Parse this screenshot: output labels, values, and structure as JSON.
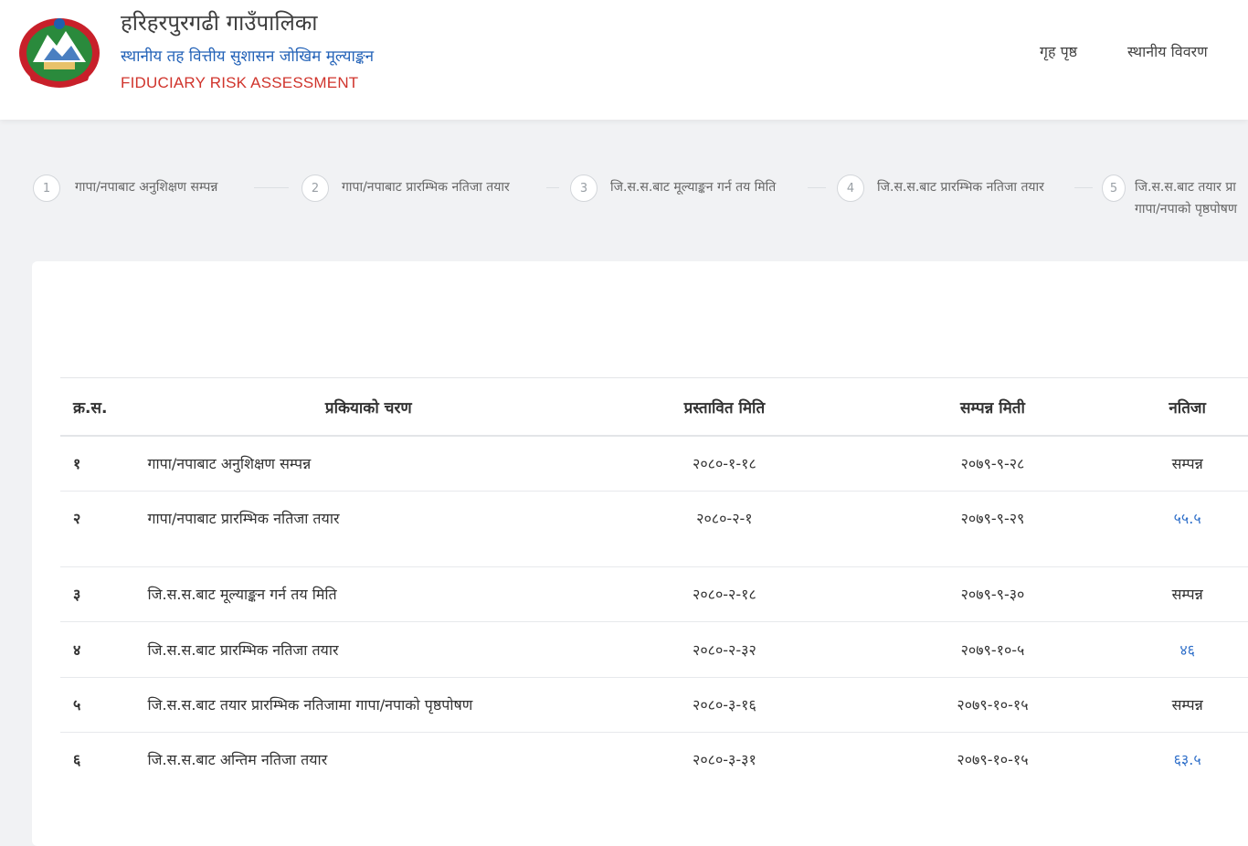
{
  "header": {
    "title": "हरिहरपुरगढी गाउँपालिका",
    "subtitle": "स्थानीय तह वित्तीय सुशासन जोखिम मूल्याङ्कन",
    "subtitle_en": "FIDUCIARY RISK ASSESSMENT",
    "nav": [
      "गृह पृष्ठ",
      "स्थानीय विवरण"
    ]
  },
  "steps": [
    {
      "num": "1",
      "label": "गापा/नपाबाट अनुशिक्षण सम्पन्न"
    },
    {
      "num": "2",
      "label": "गापा/नपाबाट प्रारम्भिक नतिजा तयार"
    },
    {
      "num": "3",
      "label": "जि.स.स.बाट मूल्याङ्कन गर्न तय मिति"
    },
    {
      "num": "4",
      "label": "जि.स.स.बाट प्रारम्भिक नतिजा तयार"
    },
    {
      "num": "5",
      "label": "जि.स.स.बाट तयार प्रा",
      "label_line2": "गापा/नपाको पृष्ठपोषण"
    }
  ],
  "table": {
    "headers": [
      "क्र.स.",
      "प्रकियाको चरण",
      "प्रस्तावित मिति",
      "सम्पन्न मिती",
      "नतिजा"
    ],
    "rows": [
      {
        "sn": "१",
        "step": "गापा/नपाबाट अनुशिक्षण सम्पन्न",
        "proposed": "२०८०-१-१८",
        "completed": "२०७९-९-२८",
        "result": "सम्पन्न"
      },
      {
        "sn": "२",
        "step": "गापा/नपाबाट प्रारम्भिक नतिजा तयार",
        "proposed": "२०८०-२-१",
        "completed": "२०७९-९-२९",
        "result": "५५.५"
      },
      {
        "sn": "३",
        "step": "जि.स.स.बाट मूल्याङ्कन गर्न तय मिति",
        "proposed": "२०८०-२-१८",
        "completed": "२०७९-९-३०",
        "result": "सम्पन्न"
      },
      {
        "sn": "४",
        "step": "जि.स.स.बाट प्रारम्भिक नतिजा तयार",
        "proposed": "२०८०-२-३२",
        "completed": "२०७९-१०-५",
        "result": "४६"
      },
      {
        "sn": "५",
        "step": "जि.स.स.बाट तयार प्रारम्भिक नतिजामा गापा/नपाको पृष्ठपोषण",
        "proposed": "२०८०-३-१६",
        "completed": "२०७९-१०-१५",
        "result": "सम्पन्न"
      },
      {
        "sn": "६",
        "step": "जि.स.स.बाट अन्तिम नतिजा तयार",
        "proposed": "२०८०-३-३१",
        "completed": "२०७९-१०-१५",
        "result": "६३.५"
      }
    ]
  },
  "colors": {
    "title_sub": "#2463b8",
    "title_en": "#d0342c",
    "score_link": "#2f6fc9"
  }
}
